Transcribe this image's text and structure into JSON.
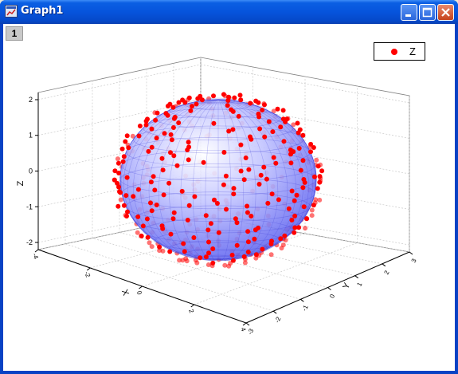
{
  "window": {
    "title": "Graph1",
    "layer_tab": "1",
    "controls": [
      "minimize",
      "maximize",
      "close"
    ]
  },
  "legend": {
    "label": "Z",
    "marker_color": "#ff0000"
  },
  "colors": {
    "titlebar": "#0654dc",
    "surface_fill": "#7e83ff",
    "mesh_line": "#3b3bd8",
    "points": "#ff0000"
  },
  "chart_data": {
    "type": "scatter",
    "title": "",
    "projection": "3d",
    "series": [
      {
        "name": "Z",
        "values": "points on ellipsoid surface"
      }
    ],
    "surface": {
      "kind": "ellipsoid",
      "semi_axes": {
        "x": 3,
        "y": 3,
        "z": 2
      },
      "style": "translucent blue mesh"
    },
    "axes": {
      "x": {
        "label": "X",
        "ticks": [
          "-4",
          "-2",
          "0",
          "2",
          "4"
        ],
        "range": [
          -4,
          4
        ]
      },
      "y": {
        "label": "Y",
        "ticks": [
          "-3",
          "-2",
          "-1",
          "0",
          "1",
          "2",
          "3"
        ],
        "range": [
          -3,
          3
        ]
      },
      "z": {
        "label": "Z",
        "ticks": [
          "-2",
          "-1",
          "0",
          "1",
          "2"
        ],
        "range": [
          -2.2,
          2.2
        ]
      }
    },
    "grid": true,
    "legend_position": "top-right",
    "point_count": 420
  }
}
